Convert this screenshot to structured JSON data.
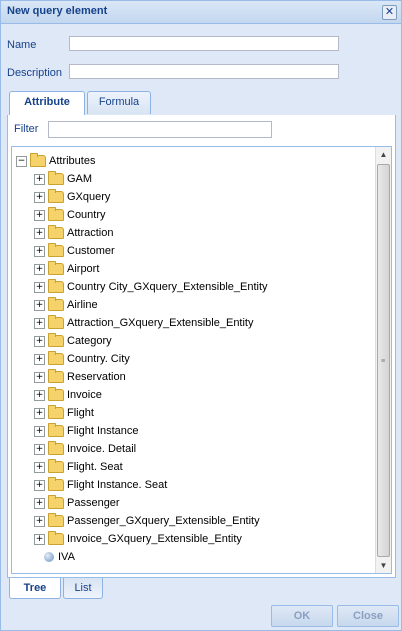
{
  "dialog": {
    "title": "New query element",
    "close_glyph": "✕"
  },
  "form": {
    "name_label": "Name",
    "name_value": "",
    "description_label": "Description",
    "description_value": ""
  },
  "tabs": [
    {
      "label": "Attribute",
      "active": true
    },
    {
      "label": "Formula",
      "active": false
    }
  ],
  "filter": {
    "label": "Filter",
    "value": ""
  },
  "tree": {
    "root": {
      "label": "Attributes",
      "expander": "⊟"
    },
    "items": [
      {
        "label": "GAM",
        "expander": "+"
      },
      {
        "label": "GXquery",
        "expander": "+"
      },
      {
        "label": "Country",
        "expander": "+"
      },
      {
        "label": "Attraction",
        "expander": "+"
      },
      {
        "label": "Customer",
        "expander": "+"
      },
      {
        "label": "Airport",
        "expander": "+"
      },
      {
        "label": "Country City_GXquery_Extensible_Entity",
        "expander": "+"
      },
      {
        "label": "Airline",
        "expander": "+"
      },
      {
        "label": "Attraction_GXquery_Extensible_Entity",
        "expander": "+"
      },
      {
        "label": "Category",
        "expander": "+"
      },
      {
        "label": "Country. City",
        "expander": "+"
      },
      {
        "label": "Reservation",
        "expander": "+"
      },
      {
        "label": "Invoice",
        "expander": "+"
      },
      {
        "label": "Flight",
        "expander": "+"
      },
      {
        "label": "Flight Instance",
        "expander": "+"
      },
      {
        "label": "Invoice. Detail",
        "expander": "+"
      },
      {
        "label": "Flight. Seat",
        "expander": "+"
      },
      {
        "label": "Flight Instance. Seat",
        "expander": "+"
      },
      {
        "label": "Passenger",
        "expander": "+"
      },
      {
        "label": "Passenger_GXquery_Extensible_Entity",
        "expander": "+"
      },
      {
        "label": "Invoice_GXquery_Extensible_Entity",
        "expander": "+"
      }
    ],
    "leaf": {
      "label": "IVA"
    }
  },
  "scrollbar": {
    "up": "▲",
    "down": "▼",
    "grip": "≡"
  },
  "bottom_tabs": [
    {
      "label": "Tree",
      "active": true
    },
    {
      "label": "List",
      "active": false
    }
  ],
  "buttons": {
    "ok": "OK",
    "close": "Close"
  }
}
